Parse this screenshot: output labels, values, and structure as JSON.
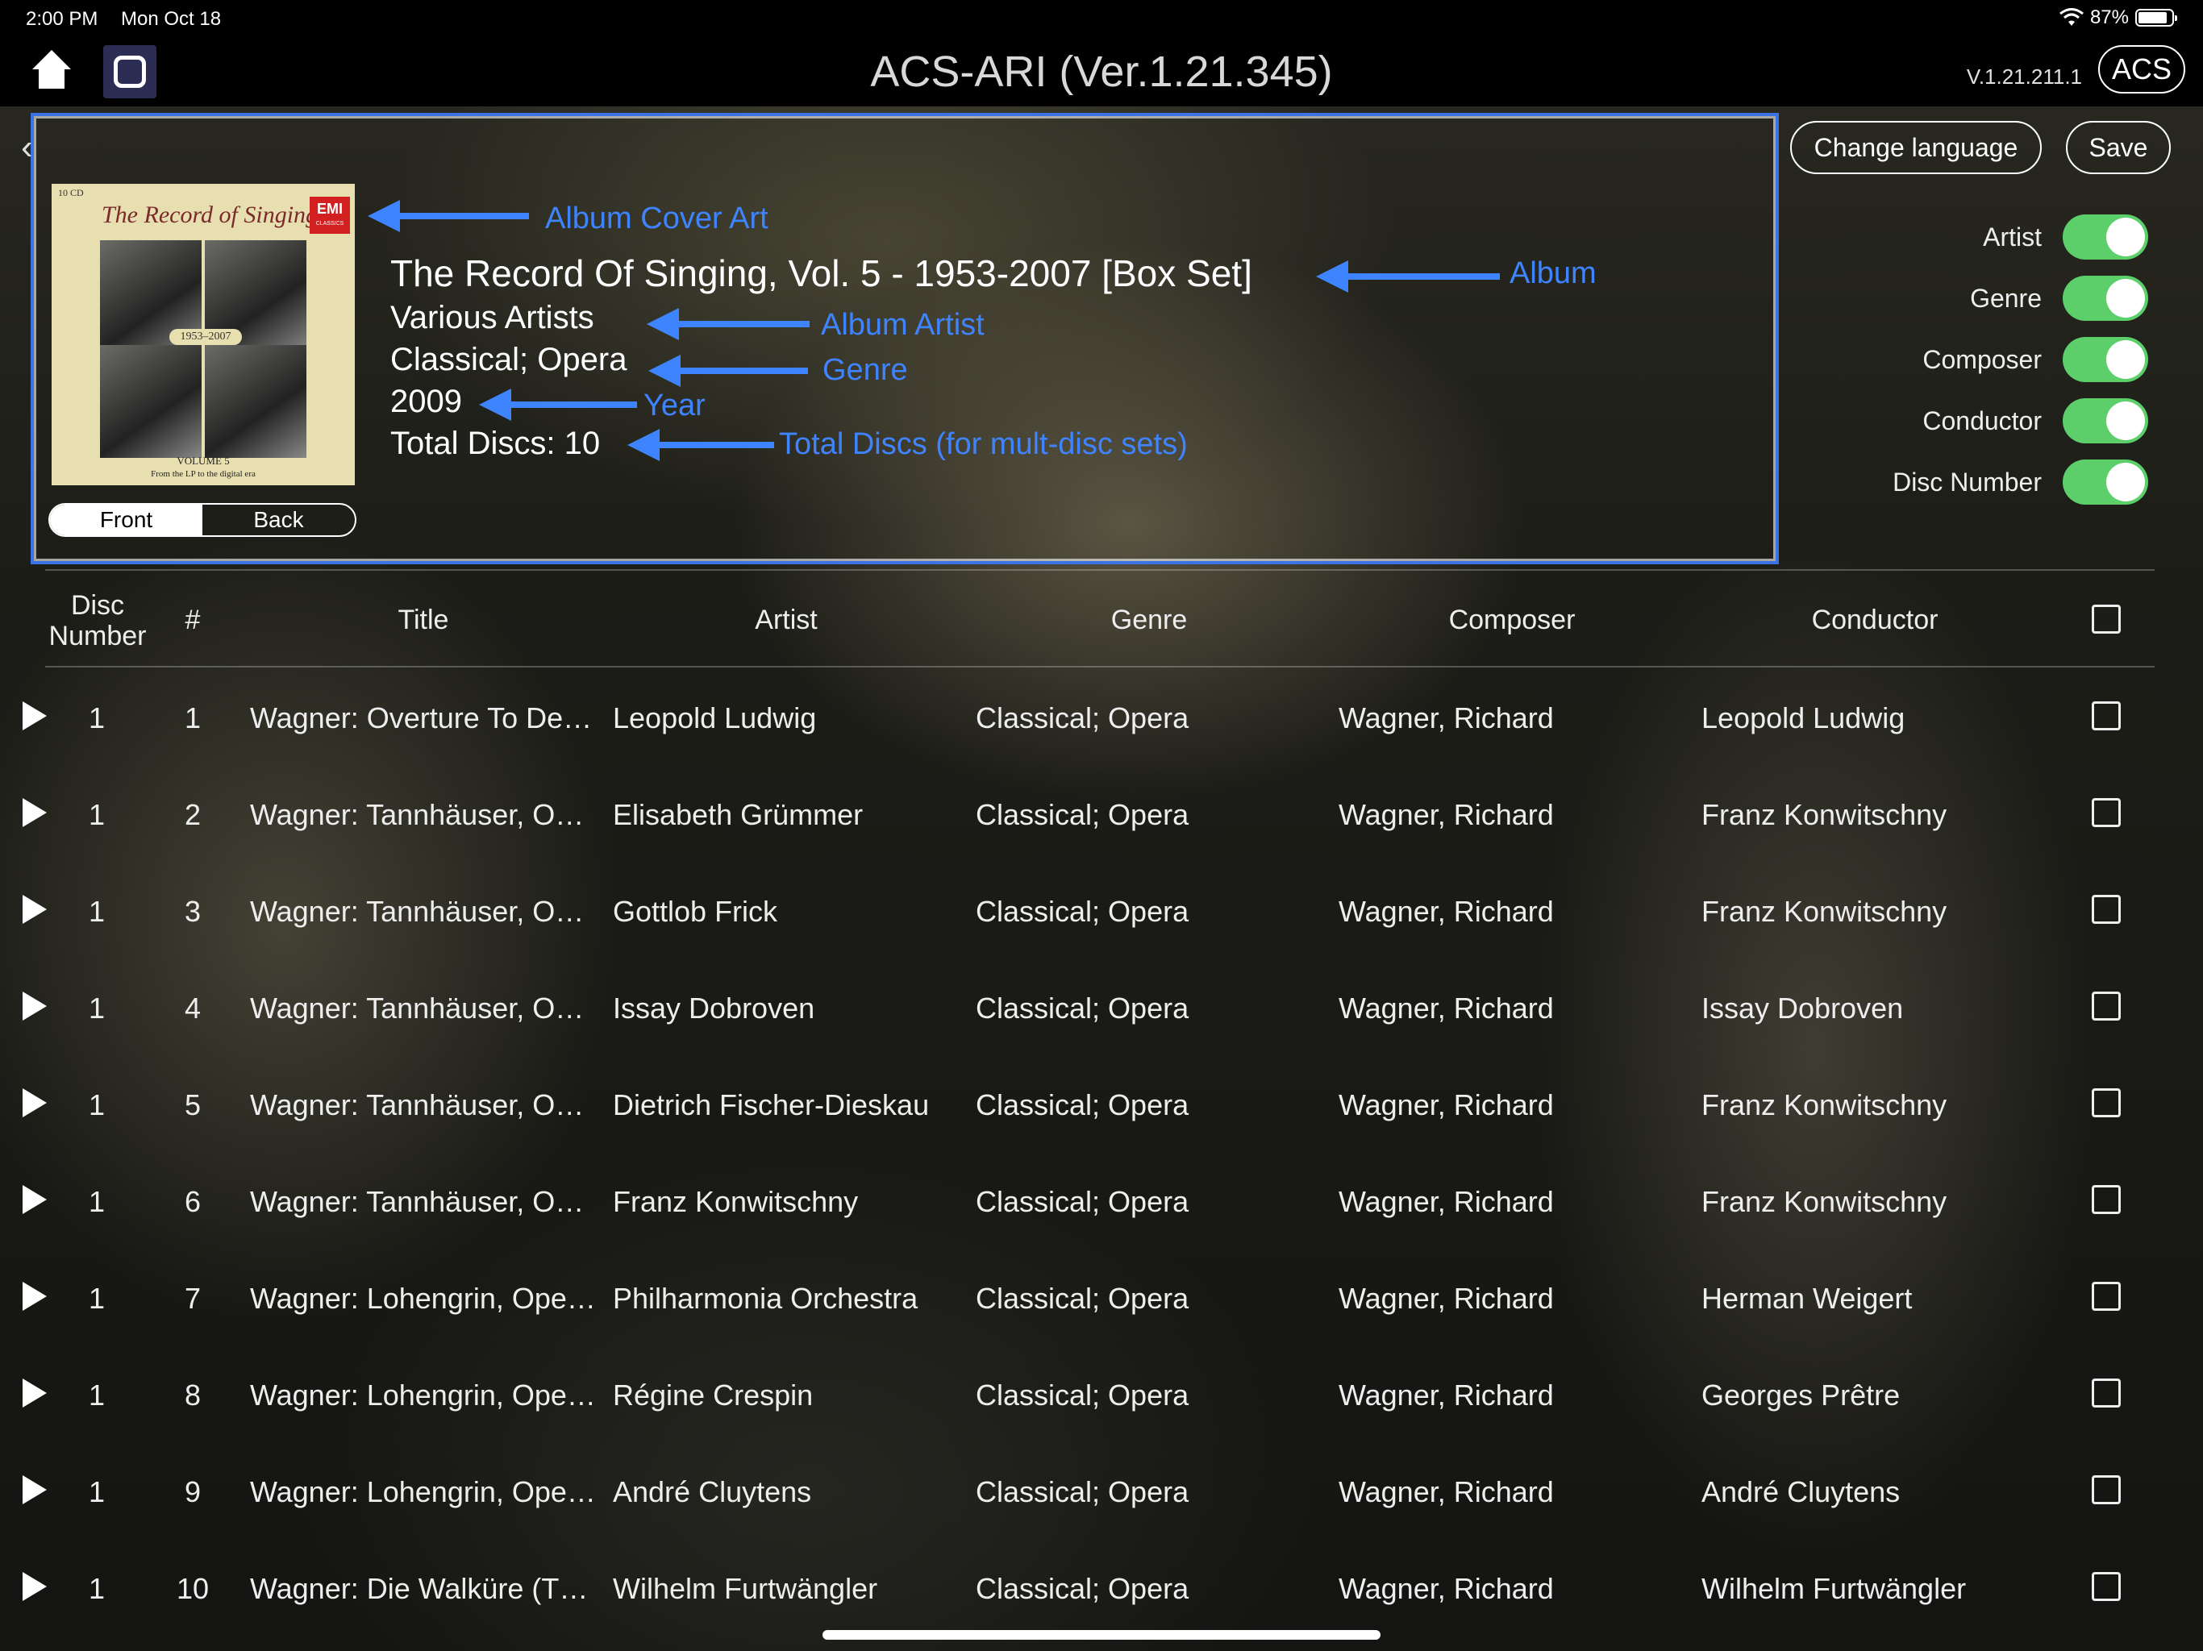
{
  "status_bar": {
    "time": "2:00 PM",
    "date": "Mon Oct 18",
    "battery": "87%",
    "battery_level": 0.87
  },
  "header": {
    "title": "ACS-ARI (Ver.1.21.345)",
    "version": "V.1.21.211.1",
    "acs_label": "ACS"
  },
  "album": {
    "cover": {
      "badge": "10 CD",
      "title": "The Record of Singing",
      "label": "EMI",
      "label_sub": "CLASSICS",
      "years": "1953–2007",
      "volume": "VOLUME 5",
      "subtitle": "From the LP to the digital era"
    },
    "title": "The Record Of Singing, Vol. 5 - 1953-2007 [Box Set]",
    "album_artist": "Various Artists",
    "genre": "Classical; Opera",
    "year": "2009",
    "total_discs": "Total Discs: 10",
    "cover_toggle": {
      "front": "Front",
      "back": "Back",
      "selected": "Front"
    }
  },
  "annotations": {
    "cover": "Album Cover Art",
    "album": "Album",
    "album_artist": "Album Artist",
    "genre": "Genre",
    "year": "Year",
    "total_discs": "Total Discs (for mult-disc sets)"
  },
  "actions": {
    "change_language": "Change language",
    "save": "Save"
  },
  "toggles": [
    {
      "label": "Artist",
      "on": true
    },
    {
      "label": "Genre",
      "on": true
    },
    {
      "label": "Composer",
      "on": true
    },
    {
      "label": "Conductor",
      "on": true
    },
    {
      "label": "Disc Number",
      "on": true
    }
  ],
  "table": {
    "headers": {
      "disc_line1": "Disc",
      "disc_line2": "Number",
      "num": "#",
      "title": "Title",
      "artist": "Artist",
      "genre": "Genre",
      "composer": "Composer",
      "conductor": "Conductor"
    },
    "rows": [
      {
        "disc": "1",
        "num": "1",
        "title": "Wagner: Overture To De…",
        "artist": "Leopold Ludwig",
        "genre": "Classical; Opera",
        "composer": "Wagner, Richard",
        "conductor": "Leopold Ludwig"
      },
      {
        "disc": "1",
        "num": "2",
        "title": "Wagner: Tannhäuser, O…",
        "artist": "Elisabeth Grümmer",
        "genre": "Classical; Opera",
        "composer": "Wagner, Richard",
        "conductor": "Franz Konwitschny"
      },
      {
        "disc": "1",
        "num": "3",
        "title": "Wagner: Tannhäuser, O…",
        "artist": "Gottlob Frick",
        "genre": "Classical; Opera",
        "composer": "Wagner, Richard",
        "conductor": "Franz Konwitschny"
      },
      {
        "disc": "1",
        "num": "4",
        "title": "Wagner: Tannhäuser, O…",
        "artist": "Issay Dobroven",
        "genre": "Classical; Opera",
        "composer": "Wagner, Richard",
        "conductor": "Issay Dobroven"
      },
      {
        "disc": "1",
        "num": "5",
        "title": "Wagner: Tannhäuser, O…",
        "artist": "Dietrich Fischer-Dieskau",
        "genre": "Classical; Opera",
        "composer": "Wagner, Richard",
        "conductor": "Franz Konwitschny"
      },
      {
        "disc": "1",
        "num": "6",
        "title": "Wagner: Tannhäuser, O…",
        "artist": "Franz Konwitschny",
        "genre": "Classical; Opera",
        "composer": "Wagner, Richard",
        "conductor": "Franz Konwitschny"
      },
      {
        "disc": "1",
        "num": "7",
        "title": "Wagner: Lohengrin, Ope…",
        "artist": "Philharmonia Orchestra",
        "genre": "Classical; Opera",
        "composer": "Wagner, Richard",
        "conductor": "Herman Weigert"
      },
      {
        "disc": "1",
        "num": "8",
        "title": "Wagner: Lohengrin, Ope…",
        "artist": "Régine Crespin",
        "genre": "Classical; Opera",
        "composer": "Wagner, Richard",
        "conductor": "Georges Prêtre"
      },
      {
        "disc": "1",
        "num": "9",
        "title": "Wagner: Lohengrin, Ope…",
        "artist": "André Cluytens",
        "genre": "Classical; Opera",
        "composer": "Wagner, Richard",
        "conductor": "André Cluytens"
      },
      {
        "disc": "1",
        "num": "10",
        "title": "Wagner: Die Walküre (T…",
        "artist": "Wilhelm Furtwängler",
        "genre": "Classical; Opera",
        "composer": "Wagner, Richard",
        "conductor": "Wilhelm Furtwängler"
      }
    ]
  },
  "colors": {
    "accent": "#3b73e6",
    "annotation": "#3f84ff",
    "toggle_on": "#5ccf6b"
  }
}
